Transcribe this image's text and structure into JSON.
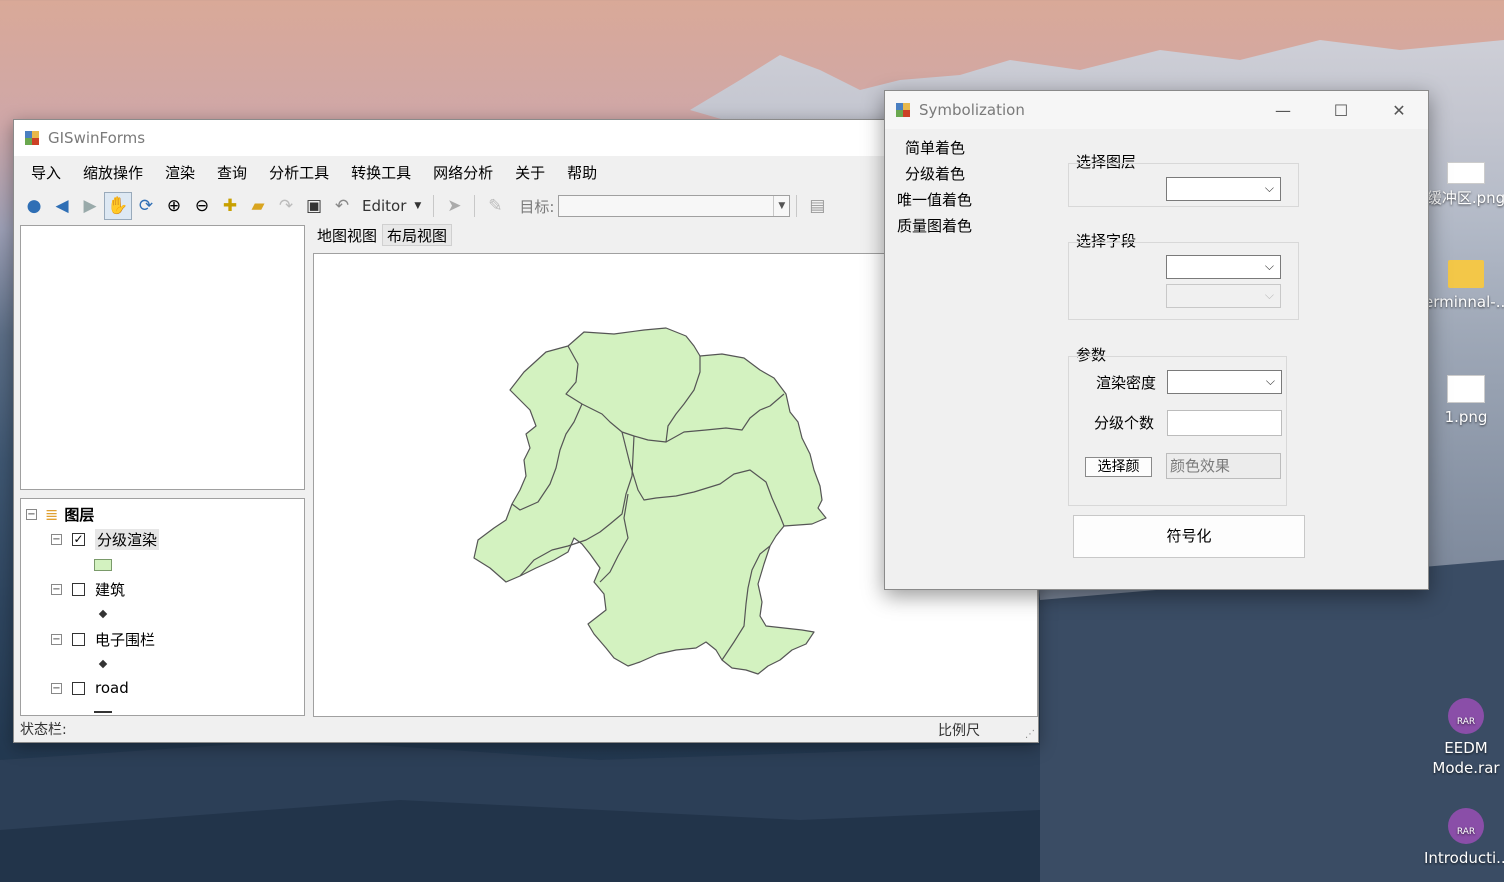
{
  "main_window": {
    "title": "GISwinForms",
    "menu": [
      "导入",
      "缩放操作",
      "渲染",
      "查询",
      "分析工具",
      "转换工具",
      "网络分析",
      "关于",
      "帮助"
    ],
    "toolbar": {
      "editor_label": "Editor",
      "target_label": "目标:"
    },
    "tabs": [
      "地图视图",
      "布局视图"
    ],
    "toc": {
      "root_label": "图层",
      "layers": [
        {
          "name": "分级渲染",
          "checked": true
        },
        {
          "name": "建筑",
          "checked": false
        },
        {
          "name": "电子围栏",
          "checked": false
        },
        {
          "name": "road",
          "checked": false
        }
      ],
      "fill_color": "#d3f2c0"
    },
    "status": {
      "left": "状态栏:",
      "scale": "比例尺"
    }
  },
  "sym_window": {
    "title": "Symbolization",
    "menu": [
      "简单着色",
      "分级着色",
      "唯一值着色",
      "质量图着色"
    ],
    "select_layer_label": "选择图层",
    "select_field_label": "选择字段",
    "params_label": "参数",
    "render_density_label": "渲染密度",
    "class_count_label": "分级个数",
    "choose_color_button": "选择颜",
    "color_effect_placeholder": "颜色效果",
    "symbolize_button": "符号化"
  },
  "desktop": {
    "icons": [
      {
        "label": "缓冲区.png",
        "kind": "image"
      },
      {
        "label": "erminnal-...",
        "kind": "folder"
      },
      {
        "label": "1.png",
        "kind": "image"
      },
      {
        "label": "EEDM Mode.rar",
        "kind": "rar"
      },
      {
        "label": "Introducti...",
        "kind": "rar"
      }
    ]
  }
}
